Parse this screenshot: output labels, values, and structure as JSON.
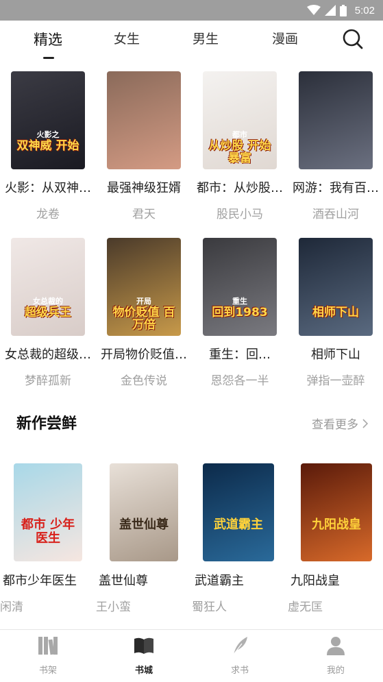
{
  "status_bar": {
    "time": "5:02"
  },
  "top_nav": {
    "tabs": [
      {
        "label": "精选",
        "active": true
      },
      {
        "label": "女生",
        "active": false
      },
      {
        "label": "男生",
        "active": false
      },
      {
        "label": "漫画",
        "active": false
      }
    ],
    "search_icon": "search-icon"
  },
  "featured": [
    {
      "title": "火影：从双神…",
      "author": "龙卷",
      "cover_text": "双神威 开始",
      "cover_sub": "火影之",
      "cover_colors": [
        "#3b3b44",
        "#1a1a22"
      ]
    },
    {
      "title": "最强神级狂婿",
      "author": "君天",
      "cover_text": "",
      "cover_sub": "",
      "cover_colors": [
        "#8a6a5a",
        "#d49b84"
      ]
    },
    {
      "title": "都市：从炒股…",
      "author": "股民小马",
      "cover_text": "从炒股 开始暴富",
      "cover_sub": "都市",
      "cover_colors": [
        "#f4f2f0",
        "#e0d8d2"
      ]
    },
    {
      "title": "网游：我有百…",
      "author": "酒吞山河",
      "cover_text": "",
      "cover_sub": "",
      "cover_colors": [
        "#2b2f3a",
        "#6b7080"
      ]
    },
    {
      "title": "女总裁的超级…",
      "author": "梦醉孤新",
      "cover_text": "超级兵王",
      "cover_sub": "女总裁的",
      "cover_colors": [
        "#f0e8e6",
        "#d8ccc8"
      ]
    },
    {
      "title": "开局物价贬值…",
      "author": "金色传说",
      "cover_text": "物价贬值 百万倍",
      "cover_sub": "开局",
      "cover_colors": [
        "#4a3a2a",
        "#c89a4a"
      ]
    },
    {
      "title": "重生：回…",
      "author": "恩怨各一半",
      "cover_text": "回到1983",
      "cover_sub": "重生",
      "cover_colors": [
        "#3a3a3e",
        "#7a7a80"
      ]
    },
    {
      "title": "相师下山",
      "author": "弹指一壶醉",
      "cover_text": "相师下山",
      "cover_sub": "",
      "cover_colors": [
        "#1e2838",
        "#5a6a80"
      ]
    }
  ],
  "new_section": {
    "title": "新作尝鲜",
    "see_more": "查看更多",
    "books": [
      {
        "title": "都市少年医生",
        "author": "闲清",
        "cover_text": "都市 少年医生",
        "cover_colors": [
          "#a8d8e8",
          "#f6e6e0"
        ]
      },
      {
        "title": "盖世仙尊",
        "author": "王小蛮",
        "cover_text": "盖世仙尊",
        "cover_colors": [
          "#e8e0d8",
          "#a89888"
        ]
      },
      {
        "title": "武道霸主",
        "author": "蜀狂人",
        "cover_text": "武道霸主",
        "cover_colors": [
          "#0c2a4a",
          "#2a6a9a"
        ]
      },
      {
        "title": "九阳战皇",
        "author": "虚无匡",
        "cover_text": "九阳战皇",
        "cover_colors": [
          "#5a1a0a",
          "#d86a2a"
        ]
      }
    ]
  },
  "bottom_nav": {
    "items": [
      {
        "label": "书架",
        "icon": "bookshelf-icon",
        "active": false
      },
      {
        "label": "书城",
        "icon": "book-store-icon",
        "active": true
      },
      {
        "label": "求书",
        "icon": "feather-icon",
        "active": false
      },
      {
        "label": "我的",
        "icon": "user-icon",
        "active": false
      }
    ]
  },
  "colors": {
    "accent": "#222222",
    "muted": "#a0a0a0",
    "status_bar": "#9e9e9e"
  }
}
